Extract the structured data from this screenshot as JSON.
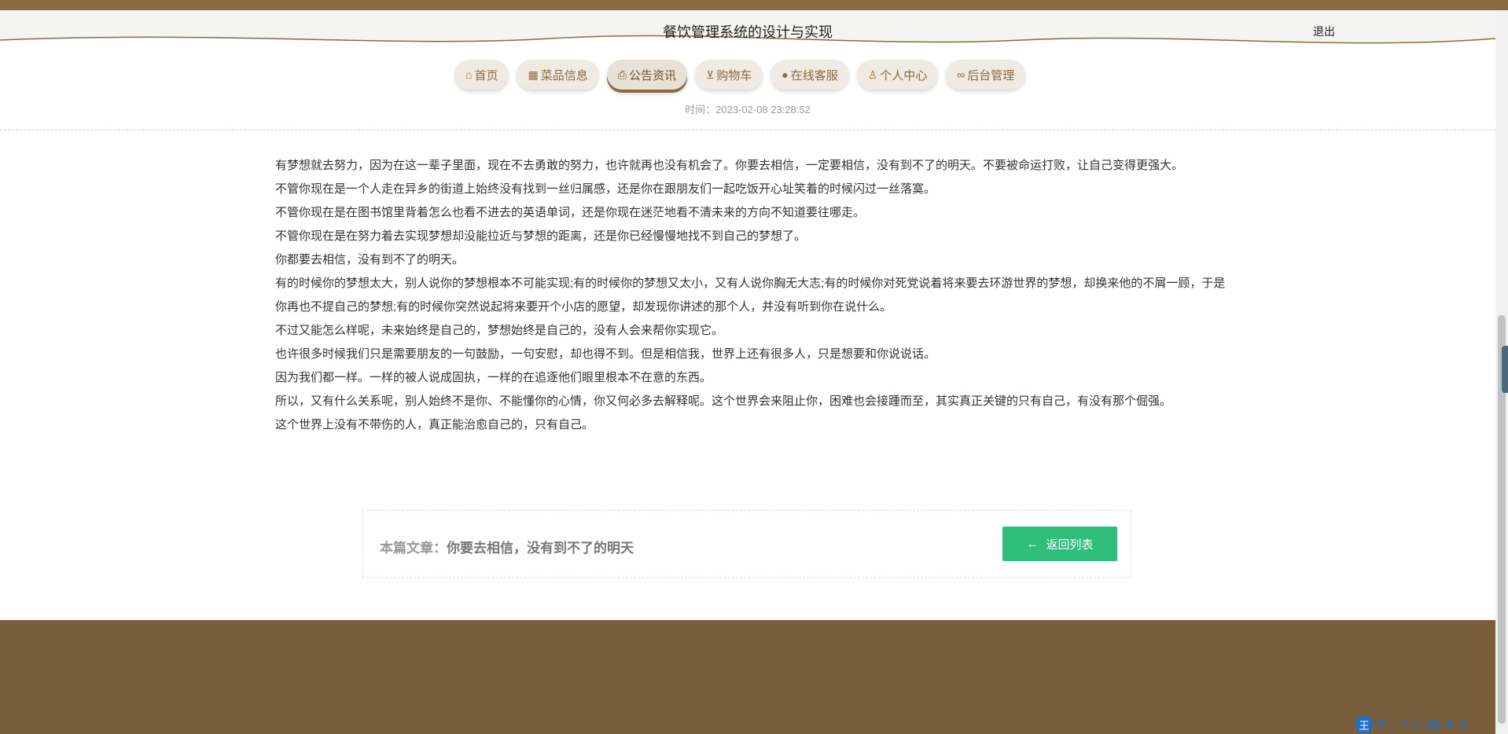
{
  "header": {
    "title": "餐饮管理系统的设计与实现",
    "logout_label": "退出"
  },
  "nav": {
    "items": [
      {
        "label": "首页",
        "icon": "home-icon"
      },
      {
        "label": "菜品信息",
        "icon": "grid-icon"
      },
      {
        "label": "公告资讯",
        "icon": "printer-icon"
      },
      {
        "label": "购物车",
        "icon": "cart-icon"
      },
      {
        "label": "在线客服",
        "icon": "chat-icon"
      },
      {
        "label": "个人中心",
        "icon": "user-icon"
      },
      {
        "label": "后台管理",
        "icon": "link-icon"
      }
    ],
    "active_label": "公告资讯"
  },
  "article": {
    "time_text": "时间：2023-02-08 23:28:52",
    "paragraphs": [
      "有梦想就去努力，因为在这一辈子里面，现在不去勇敢的努力，也许就再也没有机会了。你要去相信，一定要相信，没有到不了的明天。不要被命运打败，让自己变得更强大。",
      "不管你现在是一个人走在异乡的街道上始终没有找到一丝归属感，还是你在跟朋友们一起吃饭开心址笑着的时候闪过一丝落寞。",
      "不管你现在是在图书馆里背着怎么也看不进去的英语单词，还是你现在迷茫地看不清未来的方向不知道要往哪走。",
      "不管你现在是在努力着去实现梦想却没能拉近与梦想的距离，还是你已经慢慢地找不到自己的梦想了。",
      "你都要去相信，没有到不了的明天。",
      "有的时候你的梦想太大，别人说你的梦想根本不可能实现;有的时候你的梦想又太小，又有人说你胸无大志;有的时候你对死党说着将来要去环游世界的梦想，却换来他的不屑一顾，于是你再也不提自己的梦想;有的时候你突然说起将来要开个小店的愿望，却发现你讲述的那个人，并没有听到你在说什么。",
      "不过又能怎么样呢，未来始终是自己的，梦想始终是自己的，没有人会来帮你实现它。",
      "也许很多时候我们只是需要朋友的一句鼓励，一句安慰，却也得不到。但是相信我，世界上还有很多人，只是想要和你说说话。",
      "因为我们都一样。一样的被人说成固执，一样的在追逐他们眼里根本不在意的东西。",
      "所以，又有什么关系呢，别人始终不是你、不能懂你的心情，你又何必多去解释呢。这个世界会来阻止你，困难也会接踵而至，其实真正关键的只有自己，有没有那个倔强。",
      "这个世界上没有不带伤的人，真正能治愈自己的，只有自己。"
    ]
  },
  "footer_box": {
    "current_label": "本篇文章：",
    "current_title": "你要去相信，没有到不了的明天",
    "back_label": "返回列表",
    "back_icon": "arrow-left-icon"
  },
  "ime": {
    "logo": "王",
    "mode": "中",
    "icons": [
      "punctuation-icon",
      "pen-icon",
      "scissors-icon",
      "keyboard-icon",
      "shirt-icon",
      "gear-icon"
    ]
  },
  "colors": {
    "brand_brown": "#8a6a3f",
    "footer_brown": "#7a5e3c",
    "button_green": "#2fbf7a"
  }
}
